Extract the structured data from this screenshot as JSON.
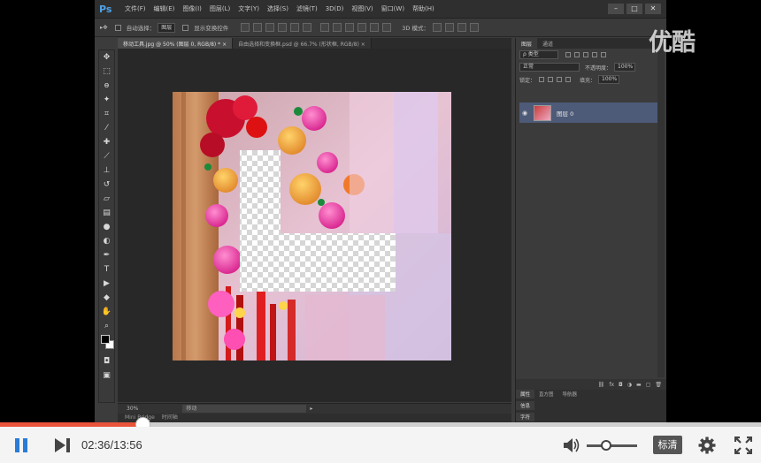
{
  "photoshop": {
    "logo": "Ps",
    "menu": [
      "文件(F)",
      "编辑(E)",
      "图像(I)",
      "图层(L)",
      "文字(Y)",
      "选择(S)",
      "滤镜(T)",
      "3D(D)",
      "视图(V)",
      "窗口(W)",
      "帮助(H)"
    ],
    "window_controls": [
      "–",
      "□",
      "✕"
    ],
    "options": {
      "auto_select_label": "自动选择：",
      "auto_select_value": "图层",
      "show_transform_label": "显示变换控件",
      "mode_3d_label": "3D 模式："
    },
    "doc_tabs": [
      {
        "label": "移动工具.jpg @ 50% (图层 0, RGB/8) *",
        "close": "×"
      },
      {
        "label": "自由选择和变换框.psd @ 66.7% (形状框, RGB/8)",
        "close": "×"
      }
    ],
    "status": {
      "zoom": "30%",
      "info": "移动"
    },
    "mini_tabs": [
      "Mini Bridge",
      "时间轴"
    ],
    "panels": {
      "tabs": [
        "图层",
        "通道"
      ],
      "filter_label": "ρ 类型",
      "blend_mode": "正常",
      "opacity_label": "不透明度：",
      "opacity_value": "100%",
      "lock_label": "锁定：",
      "fill_label": "填充：",
      "fill_value": "100%",
      "layer_name": "图层 0",
      "bottom_tabs": [
        "属性",
        "直方图",
        "导航器"
      ],
      "bottom_rows": [
        "信息",
        "字符"
      ]
    }
  },
  "watermark": "优酷",
  "player": {
    "current_time": "02:36",
    "total_time": "13:56",
    "time_display": "02:36/13:56",
    "progress": 0.187,
    "volume": 0.38,
    "quality_label": "标清",
    "colors": {
      "accent": "#e8533a",
      "play": "#2a7cd6"
    }
  }
}
